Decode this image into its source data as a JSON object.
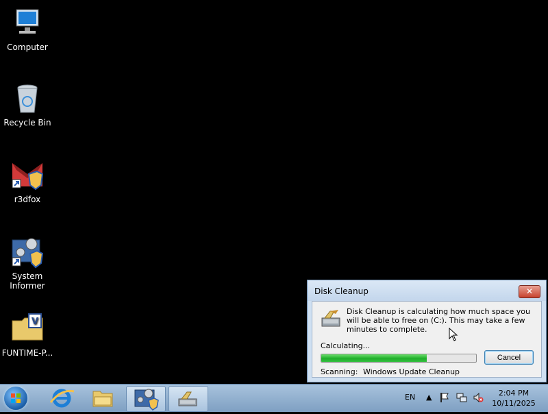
{
  "desktop": {
    "icons": [
      {
        "label": "Computer"
      },
      {
        "label": "Recycle Bin"
      },
      {
        "label": "r3dfox"
      },
      {
        "label_line1": "System",
        "label_line2": "Informer"
      },
      {
        "label": "FUNTIME-P..."
      }
    ]
  },
  "dialog": {
    "title": "Disk Cleanup",
    "close_label": "✕",
    "message": "Disk Cleanup is calculating how much space you will be able to free on  (C:). This may take a few minutes to complete.",
    "status_label": "Calculating...",
    "progress_fraction": 0.68,
    "cancel_label": "Cancel",
    "scanning_label": "Scanning:",
    "scanning_value": "Windows Update Cleanup"
  },
  "taskbar": {
    "apps": [
      "start-button",
      "internet-explorer-icon",
      "file-explorer-icon",
      "system-informer-icon",
      "disk-cleanup-icon"
    ],
    "language": "EN",
    "time": "2:04 PM",
    "date": "10/11/2025",
    "colors": {
      "taskbar": "#8fb0d2",
      "close": "#c7422e",
      "progress": "#1fae2a"
    }
  }
}
